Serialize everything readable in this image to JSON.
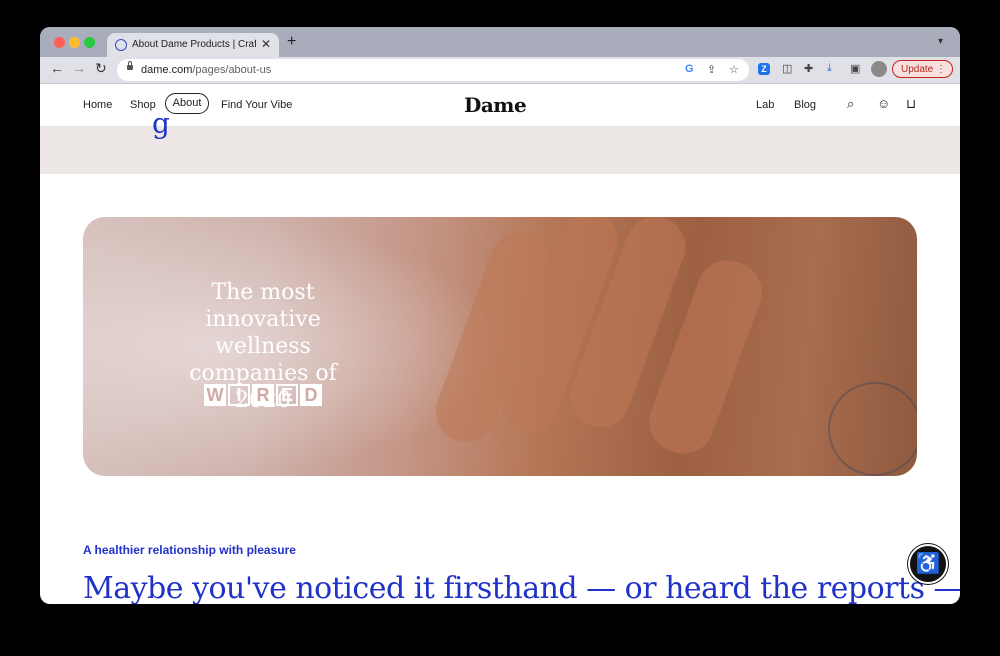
{
  "browser": {
    "tab_title": "About Dame Products | Craftin",
    "tab_close": "✕",
    "new_tab": "+",
    "url_domain": "dame.com",
    "url_path": "/pages/about-us",
    "update_label": "Update",
    "update_menu": "⋮",
    "colors": {
      "close": "#ff5f57",
      "minimize": "#febc2e",
      "maximize": "#28c840"
    }
  },
  "header": {
    "nav_left": [
      "Home",
      "Shop",
      "About",
      "Find Your Vibe"
    ],
    "logo": "Dame",
    "nav_right": [
      "Lab",
      "Blog"
    ]
  },
  "hero": {
    "quote": "The most innovative wellness companies of 2020",
    "publication": [
      "W",
      "I",
      "R",
      "E",
      "D"
    ]
  },
  "section": {
    "beige_fragment": "g",
    "eyebrow": "A healthier relationship with pleasure",
    "headline": "Maybe you've noticed it firsthand — or heard the reports — that"
  },
  "icons": [
    "search-icon",
    "account-icon",
    "bag-icon",
    "accessibility-icon"
  ],
  "brand_color": "#2132c8"
}
